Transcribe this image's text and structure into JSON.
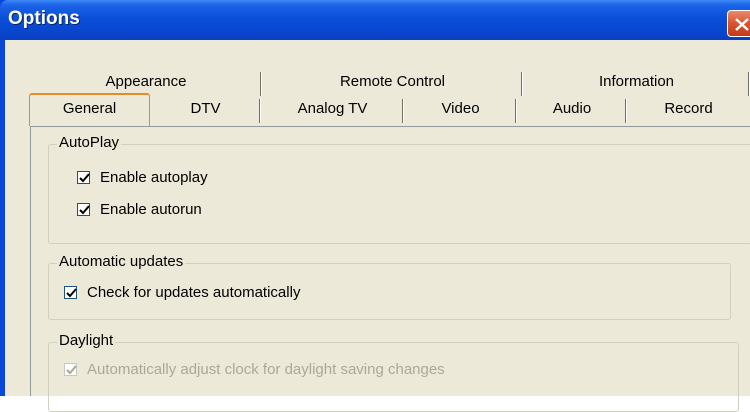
{
  "window": {
    "title": "Options"
  },
  "tabs": {
    "row_back": [
      "Appearance",
      "Remote Control",
      "Information"
    ],
    "row_front": [
      "General",
      "DTV",
      "Analog TV",
      "Video",
      "Audio",
      "Record"
    ],
    "active": "General"
  },
  "groups": {
    "autoplay": {
      "legend": "AutoPlay",
      "items": [
        {
          "label": "Enable autoplay",
          "checked": true,
          "enabled": true
        },
        {
          "label": "Enable autorun",
          "checked": true,
          "enabled": true
        }
      ]
    },
    "updates": {
      "legend": "Automatic updates",
      "items": [
        {
          "label": "Check for updates automatically",
          "checked": true,
          "enabled": true
        }
      ]
    },
    "daylight": {
      "legend": "Daylight",
      "items": [
        {
          "label": "Automatically adjust clock for daylight saving changes",
          "checked": true,
          "enabled": false
        }
      ]
    }
  }
}
